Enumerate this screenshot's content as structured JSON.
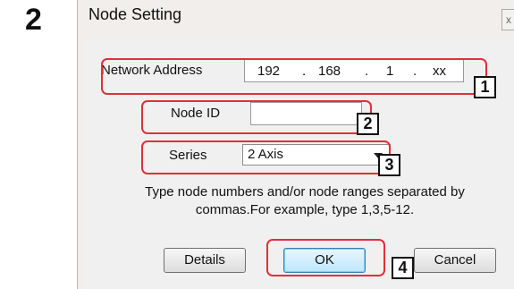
{
  "step_number": "2",
  "dialog": {
    "title": "Node Setting",
    "close_glyph": "x",
    "network_address": {
      "label": "Network Address",
      "octets": [
        "192",
        "168",
        "1",
        "xx"
      ],
      "separator": "."
    },
    "node_id": {
      "label": "Node ID",
      "value": ""
    },
    "series": {
      "label": "Series",
      "selected": "2 Axis"
    },
    "help_line1": "Type node numbers and/or node ranges separated by",
    "help_line2": "commas.For example, type 1,3,5-12.",
    "buttons": {
      "details": "Details",
      "ok": "OK",
      "cancel": "Cancel"
    }
  },
  "callouts": [
    "1",
    "2",
    "3",
    "4"
  ],
  "colors": {
    "highlight": "#e0303a",
    "ok_button": "#bee6fd",
    "dialog_bg": "#f1eeeb"
  }
}
